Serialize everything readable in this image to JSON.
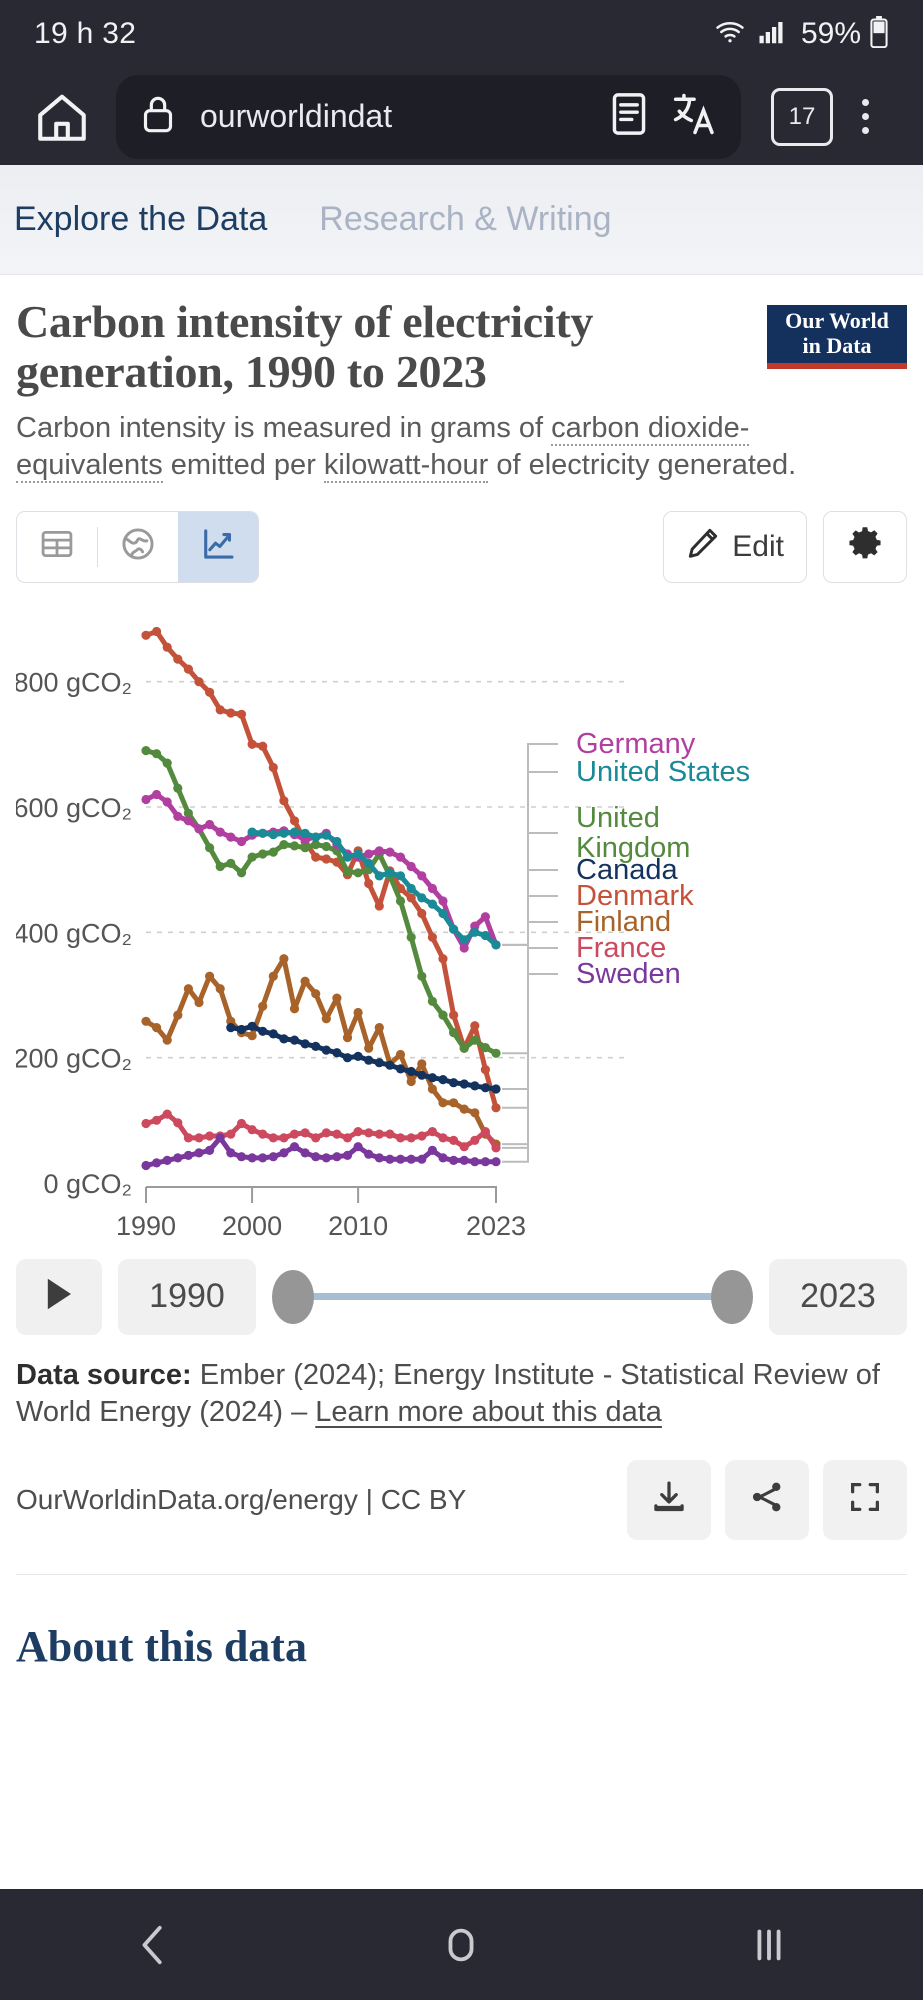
{
  "status_bar": {
    "time": "19 h 32",
    "battery_pct": "59%",
    "wifi_icon": "wifi-icon",
    "signal_icon": "cellular-signal-icon",
    "battery_icon": "battery-icon"
  },
  "browser": {
    "home_icon": "home-icon",
    "lock_icon": "lock-icon",
    "url": "ourworldindat",
    "reader_icon": "reader-mode-icon",
    "translate_icon": "translate-icon",
    "tab_count": "17",
    "menu_icon": "overflow-menu-icon"
  },
  "site_nav": {
    "tabs": [
      {
        "label": "Explore the Data",
        "active": true
      },
      {
        "label": "Research & Writing",
        "active": false
      }
    ]
  },
  "chart_card": {
    "title": "Carbon intensity of electricity generation, 1990 to 2023",
    "logo_line1": "Our World",
    "logo_line2": "in Data",
    "subtitle_parts": [
      {
        "text": "Carbon intensity is measured in grams of ",
        "link": false
      },
      {
        "text": "carbon dioxide-equivalents",
        "link": true
      },
      {
        "text": " emitted per ",
        "link": false
      },
      {
        "text": "kilowatt-hour",
        "link": true
      },
      {
        "text": " of electricity generated.",
        "link": false
      }
    ],
    "tabs": [
      {
        "name": "table-view-tab",
        "icon": "table-icon",
        "active": false
      },
      {
        "name": "map-view-tab",
        "icon": "globe-icon",
        "active": false
      },
      {
        "name": "chart-view-tab",
        "icon": "line-chart-icon",
        "active": true
      }
    ],
    "edit_label": "Edit",
    "edit_icon": "pencil-icon",
    "settings_icon": "gear-icon"
  },
  "timeline": {
    "play_icon": "play-icon",
    "start_year": "1990",
    "end_year": "2023"
  },
  "footer": {
    "source_label": "Data source:",
    "source_text": "Ember (2024); Energy Institute - Statistical Review of World Energy (2024) – ",
    "learn_more": "Learn more about this data",
    "license": "OurWorldinData.org/energy | CC BY",
    "download_icon": "download-icon",
    "share_icon": "share-icon",
    "expand_icon": "fullscreen-icon"
  },
  "about_heading": "About this data",
  "android_nav": {
    "back_icon": "back-chevron-icon",
    "home_icon": "home-circle-icon",
    "recents_icon": "recent-apps-icon"
  },
  "chart_data": {
    "type": "line",
    "title": "Carbon intensity of electricity generation, 1990 to 2023",
    "subtitle": "Carbon intensity is measured in grams of carbon dioxide-equivalents emitted per kilowatt-hour of electricity generated.",
    "xlabel": "",
    "ylabel": "gCO₂",
    "xlim": [
      1990,
      2023
    ],
    "ylim": [
      0,
      900
    ],
    "x_ticks": [
      "1990",
      "2000",
      "2010",
      "2023"
    ],
    "y_ticks": [
      "0 gCO₂",
      "200 gCO₂",
      "400 gCO₂",
      "600 gCO₂",
      "800 gCO₂"
    ],
    "y_tick_values": [
      0,
      200,
      400,
      600,
      800
    ],
    "grid": "horizontal-dashed",
    "legend_position": "right-inline",
    "markers": true,
    "x": [
      1990,
      1991,
      1992,
      1993,
      1994,
      1995,
      1996,
      1997,
      1998,
      1999,
      2000,
      2001,
      2002,
      2003,
      2004,
      2005,
      2006,
      2007,
      2008,
      2009,
      2010,
      2011,
      2012,
      2013,
      2014,
      2015,
      2016,
      2017,
      2018,
      2019,
      2020,
      2021,
      2022,
      2023
    ],
    "series": [
      {
        "name": "Denmark",
        "color": "#c4523a",
        "values": [
          874,
          880,
          855,
          836,
          820,
          800,
          783,
          755,
          750,
          748,
          700,
          697,
          663,
          610,
          578,
          545,
          520,
          517,
          512,
          492,
          530,
          478,
          442,
          498,
          470,
          455,
          430,
          392,
          358,
          268,
          215,
          251,
          181,
          120
        ]
      },
      {
        "name": "United Kingdom",
        "color": "#538a3d",
        "values": [
          690,
          685,
          670,
          630,
          590,
          565,
          535,
          505,
          510,
          495,
          520,
          525,
          528,
          540,
          538,
          535,
          540,
          537,
          530,
          497,
          495,
          500,
          525,
          490,
          450,
          392,
          330,
          290,
          268,
          240,
          215,
          228,
          216,
          207
        ]
      },
      {
        "name": "Germany",
        "color": "#b13fa0",
        "values": [
          612,
          620,
          608,
          585,
          578,
          565,
          572,
          560,
          552,
          545,
          555,
          558,
          560,
          562,
          556,
          548,
          552,
          558,
          540,
          525,
          520,
          525,
          530,
          528,
          520,
          505,
          490,
          470,
          450,
          405,
          375,
          410,
          425,
          380
        ]
      },
      {
        "name": "United States",
        "color": "#1a8a96",
        "values": [
          null,
          null,
          null,
          null,
          null,
          null,
          null,
          null,
          null,
          null,
          560,
          558,
          556,
          558,
          560,
          558,
          552,
          555,
          545,
          520,
          525,
          510,
          490,
          495,
          490,
          470,
          455,
          445,
          430,
          405,
          388,
          400,
          395,
          380
        ]
      },
      {
        "name": "Finland",
        "color": "#a8632a",
        "values": [
          258,
          248,
          228,
          268,
          310,
          288,
          330,
          310,
          258,
          240,
          235,
          282,
          330,
          358,
          278,
          322,
          302,
          262,
          295,
          232,
          272,
          215,
          248,
          190,
          205,
          162,
          190,
          150,
          128,
          128,
          118,
          112,
          78,
          62
        ]
      },
      {
        "name": "Canada",
        "color": "#13325e",
        "values": [
          null,
          null,
          null,
          null,
          null,
          null,
          null,
          null,
          248,
          245,
          250,
          242,
          238,
          230,
          228,
          222,
          218,
          212,
          208,
          200,
          202,
          196,
          192,
          188,
          182,
          178,
          172,
          168,
          165,
          160,
          158,
          155,
          152,
          150
        ]
      },
      {
        "name": "France",
        "color": "#cd4a5e",
        "values": [
          95,
          100,
          110,
          96,
          72,
          72,
          75,
          75,
          78,
          95,
          85,
          78,
          72,
          72,
          78,
          80,
          72,
          80,
          78,
          72,
          82,
          80,
          78,
          78,
          72,
          72,
          75,
          82,
          72,
          68,
          58,
          68,
          82,
          56
        ]
      },
      {
        "name": "Sweden",
        "color": "#7a379c",
        "values": [
          28,
          32,
          36,
          40,
          44,
          48,
          52,
          72,
          48,
          42,
          40,
          40,
          42,
          48,
          58,
          48,
          42,
          40,
          42,
          44,
          58,
          46,
          40,
          38,
          38,
          38,
          38,
          52,
          40,
          36,
          36,
          34,
          34,
          34
        ]
      }
    ],
    "legend_entries": [
      {
        "label": "Germany",
        "color": "#b13fa0"
      },
      {
        "label": "United States",
        "color": "#1a8a96"
      },
      {
        "label": "United Kingdom",
        "color": "#538a3d"
      },
      {
        "label": "Canada",
        "color": "#13325e"
      },
      {
        "label": "Denmark",
        "color": "#c4523a"
      },
      {
        "label": "Finland",
        "color": "#a8632a"
      },
      {
        "label": "France",
        "color": "#cd4a5e"
      },
      {
        "label": "Sweden",
        "color": "#7a379c"
      }
    ]
  }
}
